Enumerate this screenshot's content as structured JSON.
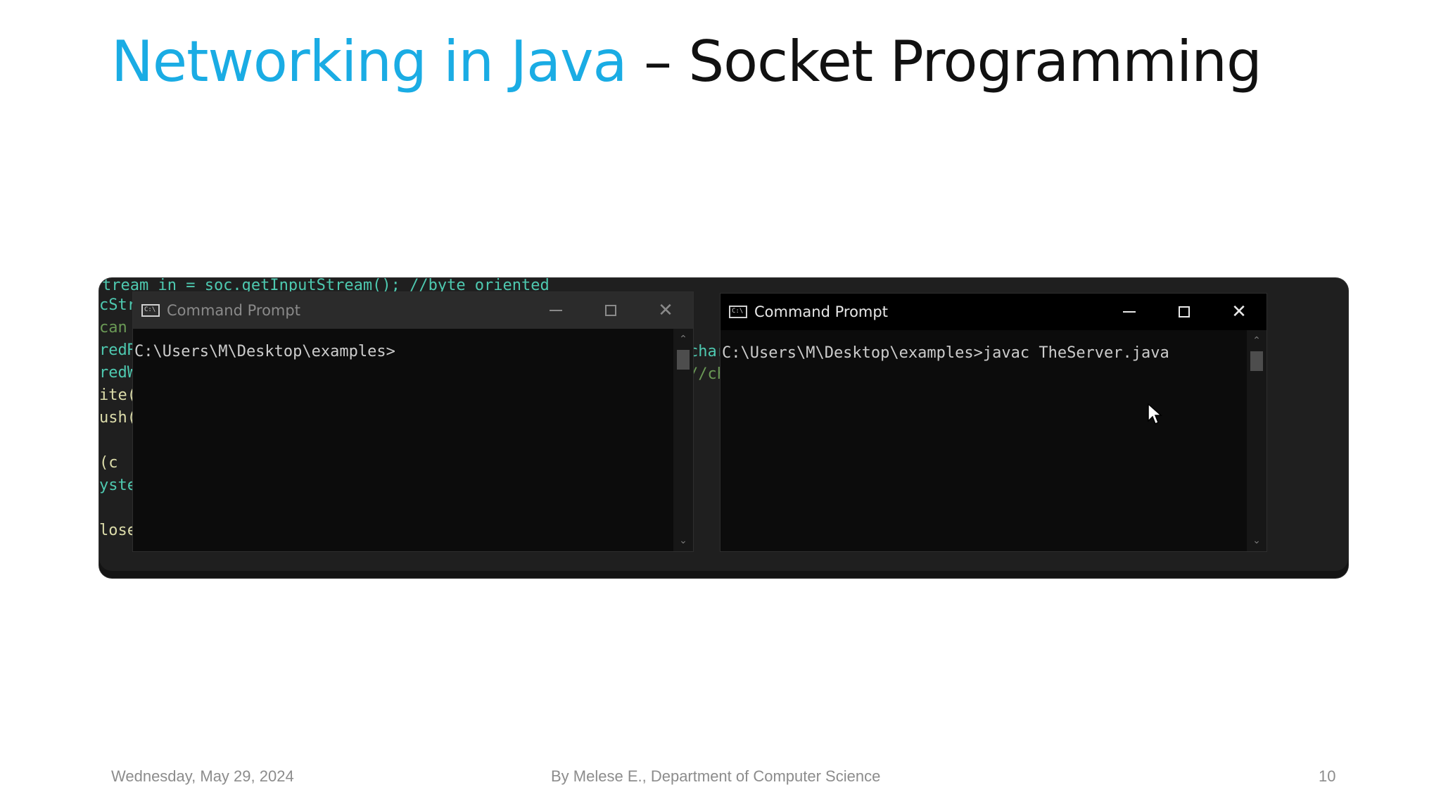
{
  "slide": {
    "title_part1": "Networking in Java",
    "title_part2": " – Socket Programming",
    "footer_date": "Wednesday, May 29, 2024",
    "footer_author": "By Melese E., Department of Computer Science",
    "page_number": "10",
    "accent_color": "#1aace4"
  },
  "background_code": {
    "top_line": "tream in = soc.getInputStream(); //byte oriented",
    "left_fragments": [
      "cStr",
      " can",
      "redR",
      "redW",
      "ite(",
      "ush(",
      "",
      "(c",
      "yste",
      "",
      "lose"
    ],
    "middle_fragments": [
      "char",
      "//ch"
    ]
  },
  "windows": [
    {
      "title": "Command Prompt",
      "active": false,
      "console_text": "C:\\Users\\M\\Desktop\\examples>"
    },
    {
      "title": "Command Prompt",
      "active": true,
      "console_text": "C:\\Users\\M\\Desktop\\examples>javac TheServer.java"
    }
  ],
  "icons": {
    "app": "cmd-app-icon",
    "minimize": "minimize-icon",
    "maximize": "maximize-icon",
    "close": "close-icon",
    "pointer": "mouse-pointer-icon"
  }
}
